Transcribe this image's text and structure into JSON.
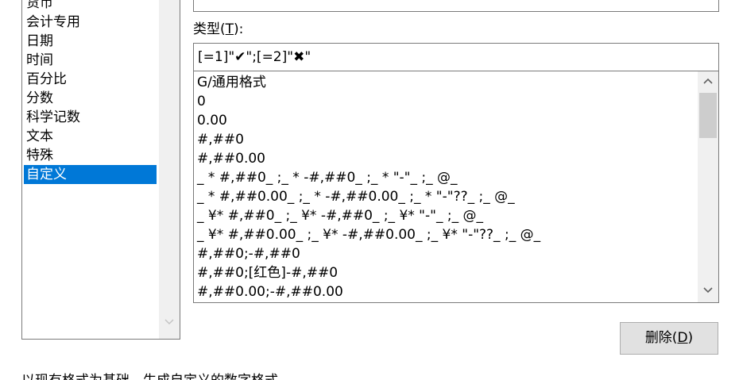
{
  "categories": {
    "items": [
      "货币",
      "会计专用",
      "日期",
      "时间",
      "百分比",
      "分数",
      "科学记数",
      "文本",
      "特殊",
      "自定义"
    ],
    "selected_index": 9
  },
  "type_field": {
    "label_prefix": "类型(",
    "label_hotkey": "T",
    "label_suffix": "):",
    "value": "[=1]\"✔\";[=2]\"✖\""
  },
  "format_list": {
    "items": [
      "G/通用格式",
      "0",
      "0.00",
      "#,##0",
      "#,##0.00",
      "_ * #,##0_ ;_ * -#,##0_ ;_ * \"-\"_ ;_ @_",
      "_ * #,##0.00_ ;_ * -#,##0.00_ ;_ * \"-\"??_ ;_ @_",
      "_ ¥* #,##0_ ;_ ¥* -#,##0_ ;_ ¥* \"-\"_ ;_ @_",
      "_ ¥* #,##0.00_ ;_ ¥* -#,##0.00_ ;_ ¥* \"-\"??_ ;_ @_",
      "#,##0;-#,##0",
      "#,##0;[红色]-#,##0",
      "#,##0.00;-#,##0.00"
    ]
  },
  "delete_button": {
    "label_prefix": "删除(",
    "label_hotkey": "D",
    "label_suffix": ")"
  },
  "description": "以现有格式为基础，生成自定义的数字格式。",
  "icons": {
    "scroll_up": "chevron-up-icon",
    "scroll_down": "chevron-down-icon"
  },
  "colors": {
    "selection": "#0078d7",
    "button_bg": "#e1e1e1",
    "scroll_thumb": "#cdcdcd"
  }
}
